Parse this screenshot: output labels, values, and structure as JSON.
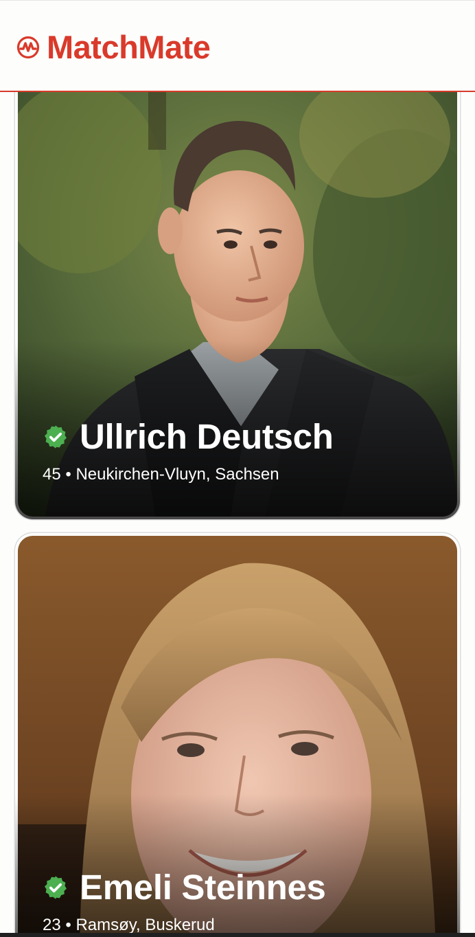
{
  "app": {
    "name": "MatchMate",
    "brand_color": "#d93a2b",
    "logo_icon": "heartbeat-logo-icon"
  },
  "feed": {
    "profiles": [
      {
        "name": "Ullrich Deutsch",
        "age": "45",
        "separator": "•",
        "location": "Neukirchen-Vluyn, Sachsen",
        "verified": true,
        "verified_icon": "verified-badge-icon",
        "verified_color": "#4caf50"
      },
      {
        "name": "Emeli Steinnes",
        "age": "23",
        "separator": "•",
        "location": "Ramsøy, Buskerud",
        "verified": true,
        "verified_icon": "verified-badge-icon",
        "verified_color": "#4caf50"
      }
    ]
  }
}
